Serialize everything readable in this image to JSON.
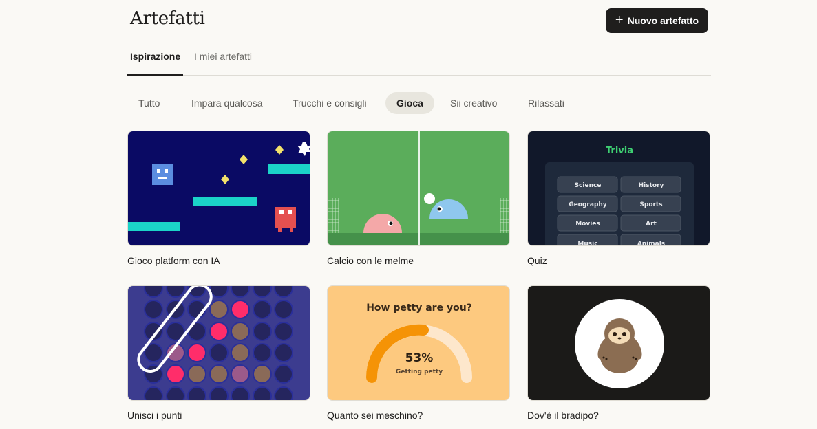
{
  "header": {
    "title": "Artefatti",
    "new_button": "Nuovo artefatto"
  },
  "tabs": [
    {
      "label": "Ispirazione"
    },
    {
      "label": "I miei artefatti"
    }
  ],
  "filters": [
    {
      "label": "Tutto"
    },
    {
      "label": "Impara qualcosa"
    },
    {
      "label": "Trucchi e consigli"
    },
    {
      "label": "Gioca"
    },
    {
      "label": "Sii creativo"
    },
    {
      "label": "Rilassati"
    }
  ],
  "cards": [
    {
      "label": "Gioco platform con IA"
    },
    {
      "label": "Calcio con le melme"
    },
    {
      "label": "Quiz",
      "trivia_title": "Trivia",
      "trivia_buttons": [
        "Science",
        "History",
        "Geography",
        "Sports",
        "Movies",
        "Art",
        "Music",
        "Animals"
      ]
    },
    {
      "label": "Unisci i punti"
    },
    {
      "label": "Quanto sei meschino?",
      "heading": "How petty are you?",
      "percent": "53%",
      "status": "Getting petty"
    },
    {
      "label": "Dov'è il bradipo?"
    }
  ],
  "colors": {
    "accent_dark": "#1f1e1d",
    "background": "#faf9f5",
    "chip_active": "#e8e6de"
  }
}
